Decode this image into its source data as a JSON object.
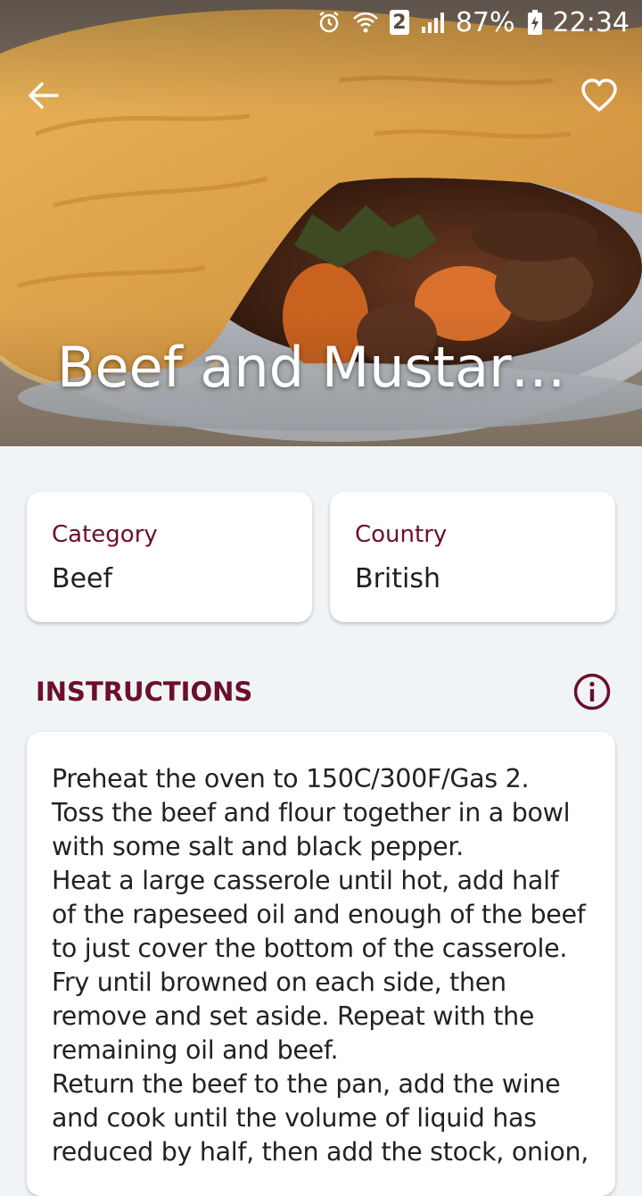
{
  "status_bar": {
    "sim_badge": "2",
    "battery_percent": "87%",
    "time": "22:34"
  },
  "header": {
    "title": "Beef and Mustard...",
    "back_icon": "arrow-left-icon",
    "favorite_icon": "heart-outline-icon"
  },
  "details": {
    "category": {
      "label": "Category",
      "value": "Beef"
    },
    "country": {
      "label": "Country",
      "value": "British"
    }
  },
  "instructions": {
    "heading": "INSTRUCTIONS",
    "info_icon": "info-icon",
    "text": "Preheat the oven to 150C/300F/Gas 2.\nToss the beef and flour together in a bowl with some salt and black pepper.\nHeat a large casserole until hot, add half of the rapeseed oil and enough of the beef to just cover the bottom of the casserole.\nFry until browned on each side, then remove and set aside. Repeat with the remaining oil and beef.\nReturn the beef to the pan, add the wine and cook until the volume of liquid has reduced by half, then add the stock, onion,"
  },
  "colors": {
    "accent": "#6b0f2b",
    "background": "#f1f4f6",
    "card": "#ffffff"
  }
}
